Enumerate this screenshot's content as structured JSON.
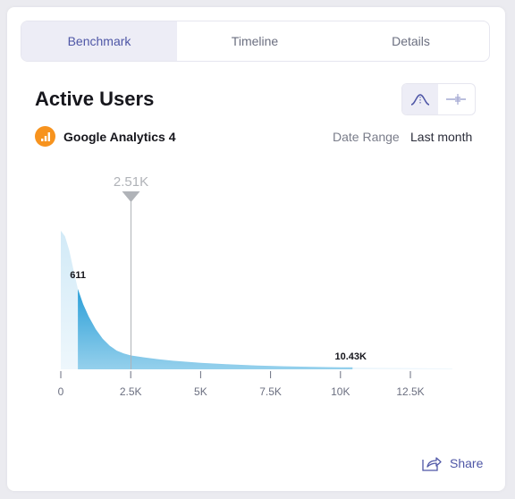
{
  "tabs": [
    {
      "label": "Benchmark",
      "active": true
    },
    {
      "label": "Timeline",
      "active": false
    },
    {
      "label": "Details",
      "active": false
    }
  ],
  "header": {
    "title": "Active Users",
    "view_toggle": [
      {
        "icon": "distribution-curve-icon",
        "active": true
      },
      {
        "icon": "range-bar-icon",
        "active": false
      }
    ]
  },
  "source": {
    "icon": "google-analytics-icon",
    "name": "Google Analytics 4"
  },
  "date_range": {
    "label": "Date Range",
    "value": "Last month"
  },
  "share": {
    "icon": "share-icon",
    "label": "Share"
  },
  "colors": {
    "accent": "#4e56a6",
    "fill_dark": "#2a9fd8",
    "fill_light": "#8fcdea",
    "fill_faint": "#e3f2fb",
    "marker": "#b0b3b8"
  },
  "chart_data": {
    "type": "area",
    "title": "Active Users distribution",
    "xlabel": "",
    "ylabel": "",
    "xlim": [
      0,
      14000
    ],
    "x_ticks": [
      0,
      2500,
      5000,
      7500,
      10000,
      12500
    ],
    "x_tick_labels": [
      "0",
      "2.5K",
      "5K",
      "7.5K",
      "10K",
      "12.5K"
    ],
    "grid": false,
    "highlight_range": {
      "low": 611,
      "high": 10430,
      "low_label": "611",
      "high_label": "10.43K"
    },
    "marker": {
      "value": 2510,
      "label": "2.51K"
    },
    "density_curve": {
      "x": [
        0,
        150,
        300,
        450,
        611,
        800,
        1000,
        1250,
        1500,
        1750,
        2000,
        2250,
        2510,
        3000,
        3500,
        4000,
        5000,
        6000,
        7000,
        8000,
        9000,
        10000,
        10430,
        11000,
        12000,
        13000,
        14000
      ],
      "y": [
        1.0,
        0.96,
        0.86,
        0.72,
        0.58,
        0.47,
        0.38,
        0.29,
        0.22,
        0.17,
        0.135,
        0.115,
        0.1,
        0.085,
        0.072,
        0.062,
        0.047,
        0.036,
        0.028,
        0.022,
        0.018,
        0.015,
        0.014,
        0.012,
        0.01,
        0.008,
        0.006
      ]
    }
  }
}
